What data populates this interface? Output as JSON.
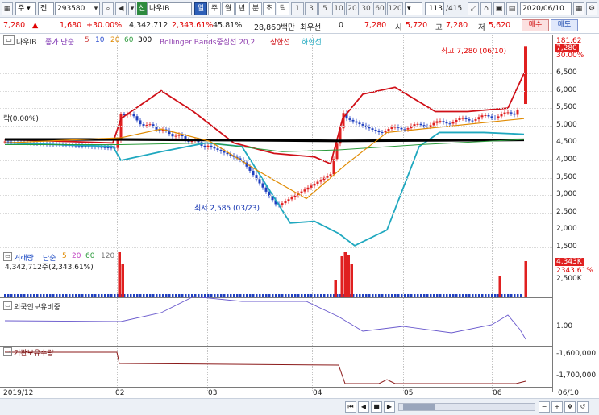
{
  "toolbar": {
    "mode_select": "주",
    "view_select": "전",
    "code": "293580",
    "stock_name": "나우IB",
    "badge_sin": "신",
    "periods": [
      "일",
      "주",
      "월",
      "년",
      "분",
      "초",
      "틱"
    ],
    "period_numbers": [
      "1",
      "3",
      "5",
      "10",
      "20",
      "30",
      "60",
      "120"
    ],
    "count": "113",
    "count_total": "/415",
    "date": "2020/06/10"
  },
  "quote": {
    "price": "7,280",
    "change": "1,680",
    "change_pct": "+30.00%",
    "volume": "4,342,712",
    "vol_ratio": "2,343.61%",
    "turnover": "45.81%",
    "amount": "28,860백만",
    "pref_label": "최우선",
    "pref_value": "0",
    "last": "7,280",
    "open_label": "시",
    "open": "5,720",
    "high_label": "고",
    "high": "7,280",
    "low_label": "저",
    "low": "5,620",
    "buy_label": "매수",
    "sell_label": "매도"
  },
  "legend": {
    "stock": "나우IB",
    "price_ma": "종가 단순",
    "ma_periods": [
      "5",
      "10",
      "20",
      "60",
      "300"
    ],
    "bollinger": "Bollinger Bands중심선 20,2",
    "upper": "상한선",
    "lower": "하한선",
    "left_note": "락(0.00%)",
    "max_note": "최고 7,280 (06/10)",
    "min_note": "최저 2,585 (03/23)",
    "vol_title": "거래량",
    "vol_ma": "단순",
    "vol_periods": [
      "5",
      "20",
      "60",
      "120"
    ],
    "vol_info": "4,342,712주(2,343.61%)",
    "foreign_title": "외국인보유비중",
    "inst_title": "기관보유수량"
  },
  "price_axis": {
    "top_label": "181.62",
    "top_pct": "30.00%",
    "current": "7,280",
    "ticks": [
      "6,500",
      "6,000",
      "5,500",
      "5,000",
      "4,500",
      "4,000",
      "3,500",
      "3,000",
      "2,500",
      "2,000",
      "1,500"
    ]
  },
  "volume_axis": {
    "current": "4,343K",
    "pct": "2343.61%",
    "tick": "2,500K"
  },
  "foreign_axis": {
    "tick": "1.00"
  },
  "inst_axis": {
    "ticks": [
      "-1,600,000",
      "-1,700,000"
    ]
  },
  "x_axis": {
    "ticks": [
      "2019/12",
      "02",
      "03",
      "04",
      "05",
      "06",
      "06/10"
    ]
  },
  "colors": {
    "up": "#e02020",
    "down": "#1f3fc0",
    "boll_upper": "#d01018",
    "boll_lower": "#1fa8bf",
    "ma300": "#000000"
  },
  "chart_data": {
    "type": "candlestick",
    "period": "2019/12 ~ 2020/06/10",
    "price_high": {
      "value": 7280,
      "date": "06/10"
    },
    "price_low": {
      "value": 2585,
      "date": "03/23"
    },
    "last_close": 7280,
    "ylim": [
      1500,
      7280
    ]
  }
}
